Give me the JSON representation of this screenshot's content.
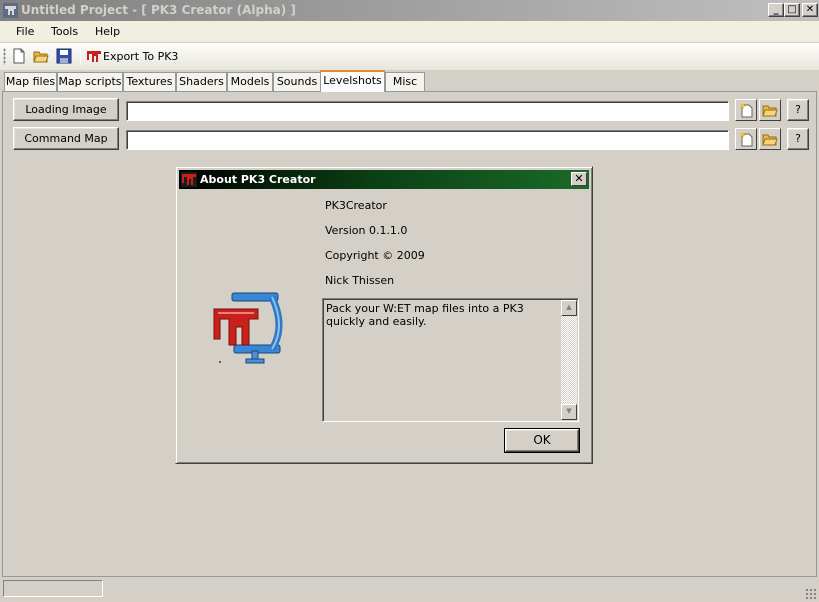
{
  "window": {
    "title": "Untitled Project - [ PK3 Creator (Alpha) ]",
    "controls": {
      "minimize": "_",
      "maximize": "□",
      "close": "✕"
    }
  },
  "menu": {
    "items": [
      "File",
      "Tools",
      "Help"
    ]
  },
  "toolbar": {
    "export_label": "Export To PK3",
    "icons": [
      "new-file-icon",
      "open-folder-icon",
      "save-icon",
      "pk3-logo-icon"
    ]
  },
  "tabs": {
    "items": [
      "Map files",
      "Map scripts",
      "Textures",
      "Shaders",
      "Models",
      "Sounds",
      "Levelshots",
      "Misc"
    ],
    "active": "Levelshots"
  },
  "levelshots": {
    "loading_image": {
      "button": "Loading Image",
      "value": "",
      "help": "?"
    },
    "command_map": {
      "button": "Command Map",
      "value": "",
      "help": "?"
    }
  },
  "about": {
    "title": "About PK3 Creator",
    "close": "✕",
    "product": "PK3Creator",
    "version": "Version 0.1.1.0",
    "copyright": "Copyright ©  2009",
    "author": "Nick Thissen",
    "description": "Pack your W:ET map files into a PK3 quickly and easily.",
    "ok_label": "OK"
  },
  "status": {
    "text": ""
  },
  "colors": {
    "accent_tab": "#e68b2c",
    "dialog_title_start": "#000000",
    "dialog_title_end": "#1b6b28",
    "logo_red": "#c8211c",
    "clamp_blue": "#2f78c4"
  }
}
